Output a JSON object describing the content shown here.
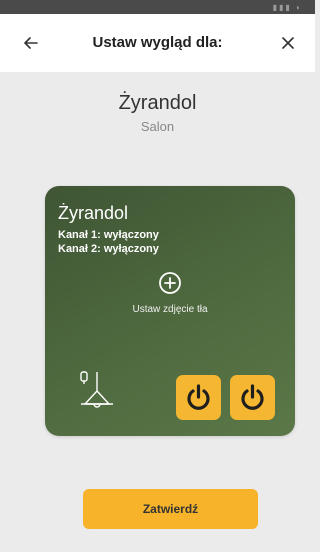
{
  "header": {
    "back_icon": "arrow-left-icon",
    "title": "Ustaw wygląd dla:",
    "close_icon": "close-icon"
  },
  "device": {
    "name": "Żyrandol",
    "room": "Salon"
  },
  "card": {
    "title": "Żyrandol",
    "channel_1": "Kanał 1: wyłączony",
    "channel_2": "Kanał 2: wyłączony",
    "add_photo_label": "Ustaw zdjęcie tła",
    "icons": {
      "add": "plus-circle-icon",
      "device": "chandelier-icon",
      "power": "power-icon"
    },
    "background_color": "#4f6a3f",
    "button_color": "#f5b731"
  },
  "footer": {
    "confirm_label": "Zatwierdź"
  }
}
